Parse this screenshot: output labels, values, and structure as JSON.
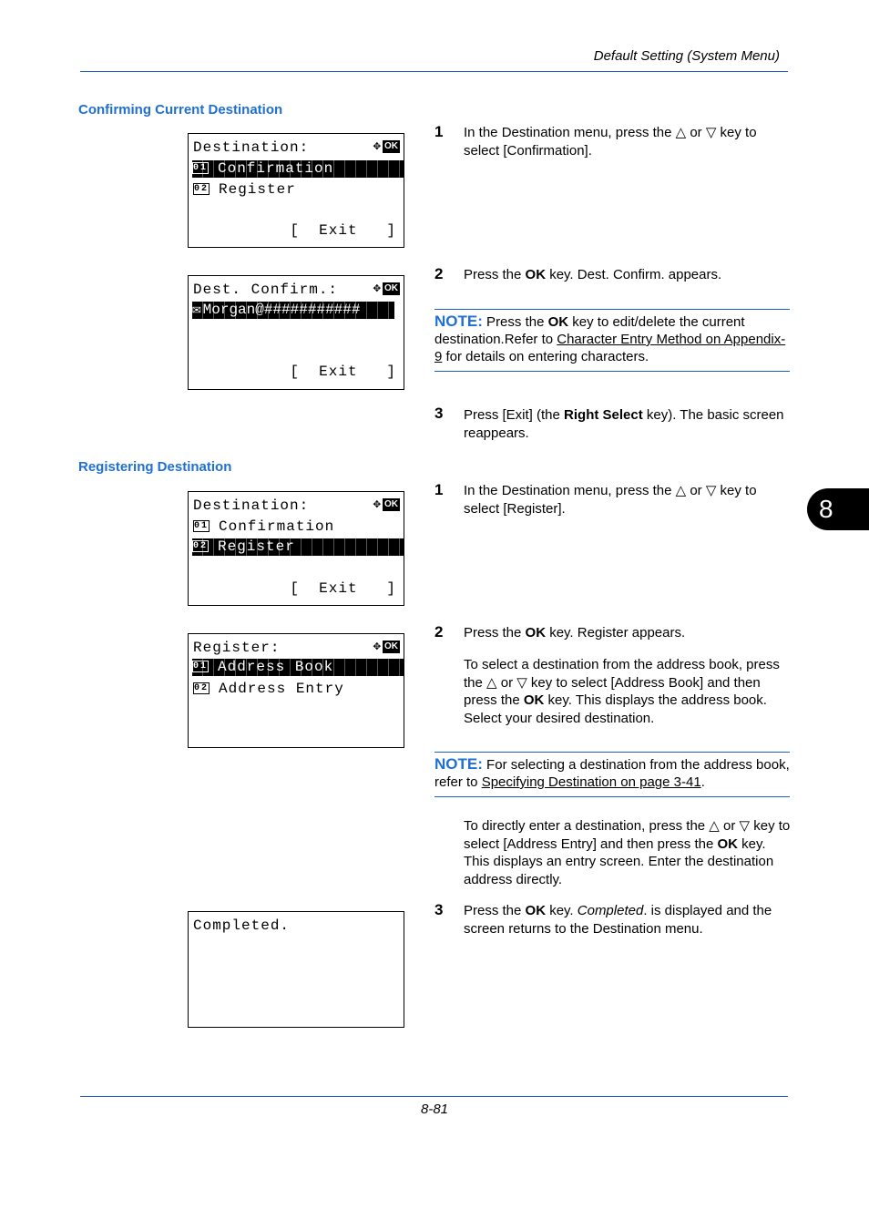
{
  "header": {
    "title": "Default Setting (System Menu)"
  },
  "chapter_tab": "8",
  "footer": {
    "page": "8-81"
  },
  "sections": {
    "confirm": {
      "title": "Confirming Current Destination",
      "screens": {
        "s1": {
          "title": "Destination:",
          "items": [
            {
              "num": "01",
              "label": "Confirmation",
              "selected": true
            },
            {
              "num": "02",
              "label": "Register",
              "selected": false
            }
          ],
          "softkey": "[  Exit   ]"
        },
        "s2": {
          "title": "Dest. Confirm.:",
          "value": "Morgan@###########",
          "softkey": "[  Exit   ]"
        }
      },
      "steps": {
        "s1": {
          "num": "1",
          "pre": "In the Destination menu, press the △ or ▽ key to select [Confirmation]."
        },
        "s2": {
          "num": "2",
          "pre": "Press the ",
          "bold": "OK",
          "post": " key. Dest. Confirm. appears."
        },
        "s3": {
          "num": "3",
          "pre": "Press [Exit] (the ",
          "bold": "Right Select",
          "post": " key). The basic screen reappears."
        }
      },
      "note": {
        "label": "NOTE:",
        "pre": " Press the ",
        "bold": "OK",
        "mid": " key to edit/delete the current destination.Refer to ",
        "link": "Character Entry Method on Appendix-9",
        "post": " for details on entering characters."
      }
    },
    "register": {
      "title": "Registering Destination",
      "screens": {
        "s1": {
          "title": "Destination:",
          "items": [
            {
              "num": "01",
              "label": "Confirmation",
              "selected": false
            },
            {
              "num": "02",
              "label": "Register",
              "selected": true
            }
          ],
          "softkey": "[  Exit   ]"
        },
        "s2": {
          "title": "Register:",
          "items": [
            {
              "num": "01",
              "label": "Address Book",
              "selected": true
            },
            {
              "num": "02",
              "label": "Address Entry",
              "selected": false
            }
          ]
        },
        "s3": {
          "title": "Completed."
        }
      },
      "steps": {
        "s1": {
          "num": "1",
          "pre": "In the Destination menu, press the △ or ▽ key to select [Register]."
        },
        "s2": {
          "num": "2",
          "pre": "Press the ",
          "bold": "OK",
          "post": " key. Register appears."
        },
        "s2b": {
          "pre": "To select a destination from the address book, press the △ or ▽ key to select [Address Book] and then press the ",
          "bold": "OK",
          "post": " key. This displays the address book. Select your desired destination."
        },
        "s2c": {
          "pre": "To directly enter a destination, press the △ or ▽ key to select [Address Entry] and then press the ",
          "bold": "OK",
          "post": " key. This displays an entry screen. Enter the destination address directly."
        },
        "s3": {
          "num": "3",
          "pre": "Press the ",
          "bold": "OK",
          "mid": " key. ",
          "italic": "Completed",
          "post": ". is displayed and the screen returns to the Destination menu."
        }
      },
      "note": {
        "label": "NOTE:",
        "pre": " For selecting a destination from the address book, refer to ",
        "link": "Specifying Destination on page 3-41",
        "post": "."
      }
    }
  }
}
